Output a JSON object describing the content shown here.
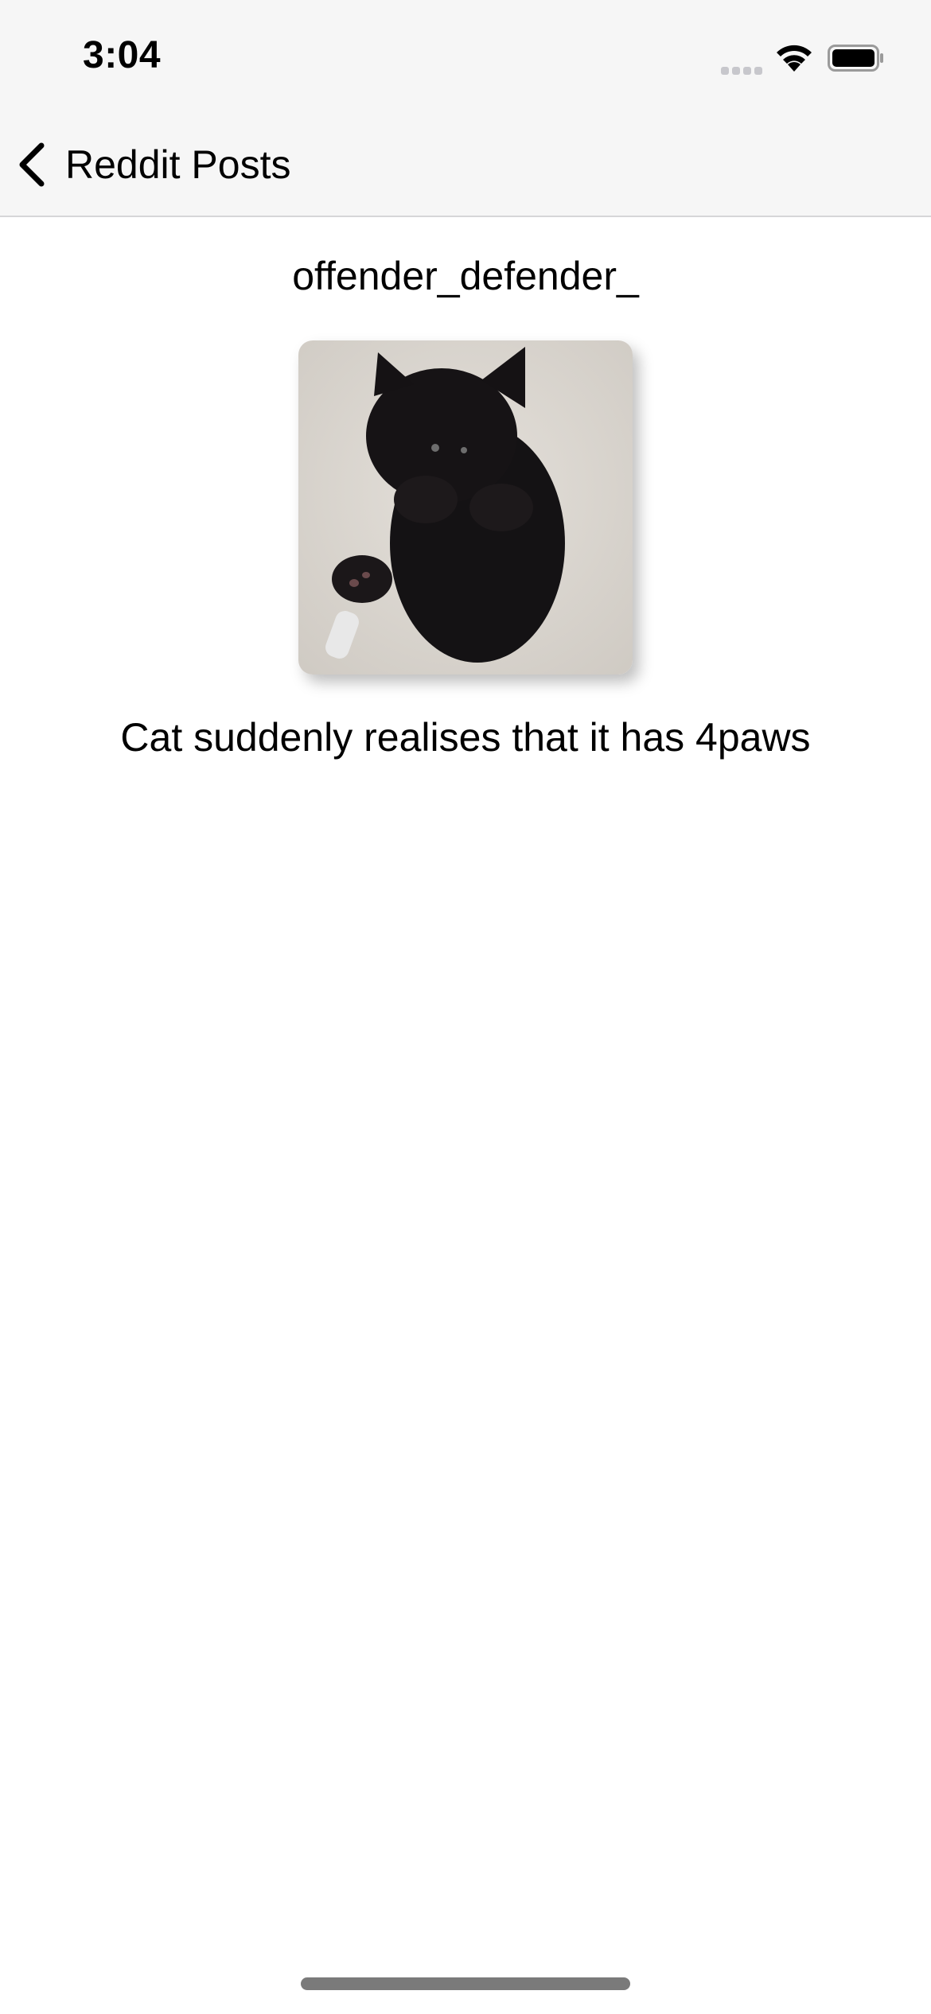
{
  "status_bar": {
    "time": "3:04",
    "signal_icon": "cellular-signal-icon",
    "wifi_icon": "wifi-icon",
    "battery_icon": "battery-icon"
  },
  "nav": {
    "back_icon": "chevron-left-icon",
    "back_label": "Reddit Posts"
  },
  "post": {
    "author": "offender_defender_",
    "image": "black kitten lying on its back on a light carpet",
    "title": "Cat suddenly realises that it has 4paws"
  },
  "colors": {
    "nav_background": "#f6f6f6",
    "separator": "#d6d6d8",
    "background": "#ffffff",
    "text": "#000000"
  }
}
